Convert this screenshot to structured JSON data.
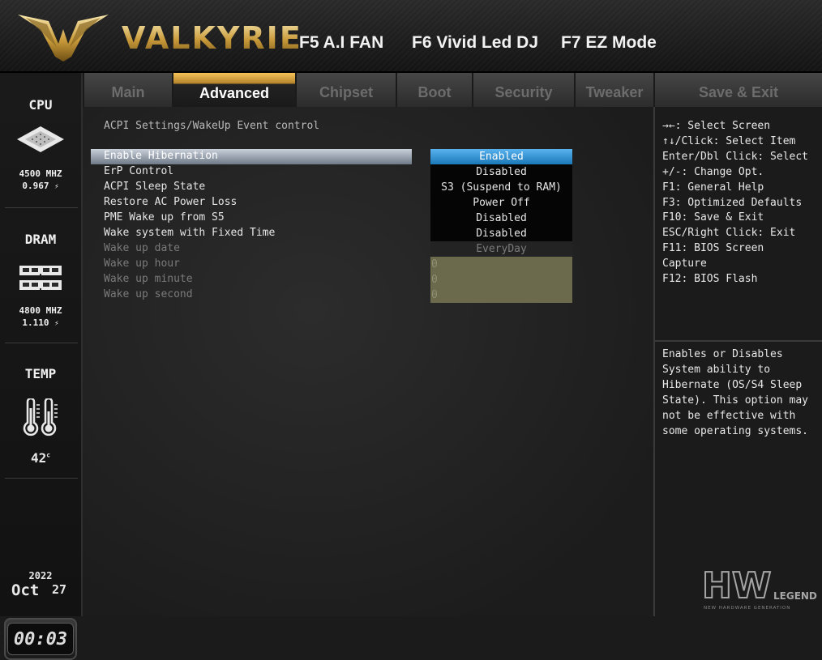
{
  "header": {
    "brand": "VALKYRIE",
    "hotkeys": [
      "F5 A.I FAN",
      "F6 Vivid Led DJ",
      "F7 EZ Mode"
    ]
  },
  "tabs": [
    {
      "label": "Main"
    },
    {
      "label": "Advanced"
    },
    {
      "label": "Chipset"
    },
    {
      "label": "Boot"
    },
    {
      "label": "Security"
    },
    {
      "label": "Tweaker"
    },
    {
      "label": "Save & Exit"
    }
  ],
  "active_tab": "Advanced",
  "status": {
    "cpu_title": "CPU",
    "cpu_freq": "4500 MHZ",
    "cpu_volt": "0.967",
    "dram_title": "DRAM",
    "dram_freq": "4800 MHZ",
    "dram_volt": "1.110",
    "temp_title": "TEMP",
    "temp_value": "42",
    "temp_unit": "c",
    "bolt_glyph": "⚡",
    "year": "2022",
    "month": "Oct",
    "day": "27",
    "time": "00:03"
  },
  "breadcrumb": "ACPI Settings/WakeUp Event control",
  "settings": [
    {
      "label": "Enable Hibernation",
      "value": "Enabled"
    },
    {
      "label": "ErP Control",
      "value": "Disabled"
    },
    {
      "label": "ACPI Sleep State",
      "value": "S3 (Suspend to RAM)"
    },
    {
      "label": "Restore AC Power Loss",
      "value": "Power Off"
    },
    {
      "label": "PME Wake up from S5",
      "value": "Disabled"
    },
    {
      "label": "Wake system with Fixed Time",
      "value": "Disabled"
    },
    {
      "label": "Wake up date",
      "value": "EveryDay"
    },
    {
      "label": "Wake up hour",
      "value": "0"
    },
    {
      "label": "Wake up minute",
      "value": "0"
    },
    {
      "label": "Wake up second",
      "value": "0"
    }
  ],
  "key_help": [
    "→←: Select Screen",
    "↑↓/Click: Select Item",
    "Enter/Dbl Click: Select",
    "+/-: Change Opt.",
    "F1: General Help",
    "F3: Optimized Defaults",
    "F10: Save & Exit",
    "ESC/Right Click: Exit",
    "F11: BIOS Screen",
    "Capture",
    "F12: BIOS Flash"
  ],
  "help_text": "Enables or Disables System ability to Hibernate (OS/S4 Sleep State). This option may not be effective with some operating systems.",
  "watermark": {
    "main": "HW",
    "word": "LEGEND",
    "tagline": "NEW HARDWARE GENERATION"
  },
  "colors": {
    "gold": "#c99a3a",
    "selected_value": "#1b78b8",
    "selected_label_bar": "#9aa4b2",
    "disabled_field": "#6b6a4c"
  }
}
